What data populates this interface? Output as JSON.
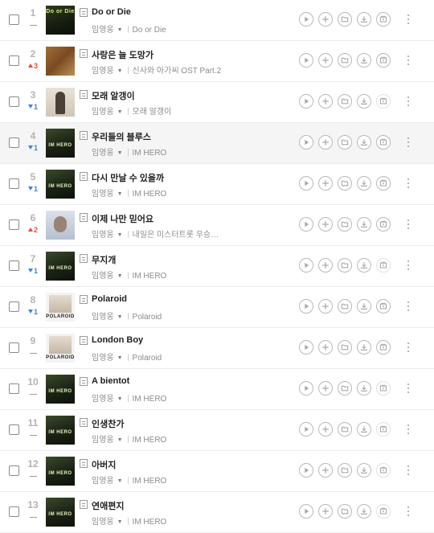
{
  "tracks": [
    {
      "rank": "1",
      "change": {
        "dir": "same",
        "value": ""
      },
      "title": "Do or Die",
      "artist": "임영웅",
      "album": "Do or Die",
      "art": "dord",
      "cover_text": "Do or Die",
      "last_active": true
    },
    {
      "rank": "2",
      "change": {
        "dir": "up",
        "value": "3"
      },
      "title": "사랑은 늘 도망가",
      "artist": "임영웅",
      "album": "신사와 아가씨 OST Part.2",
      "art": "love",
      "cover_text": "",
      "last_active": true
    },
    {
      "rank": "3",
      "change": {
        "dir": "down",
        "value": "1"
      },
      "title": "모래 알갱이",
      "artist": "임영웅",
      "album": "모래 알갱이",
      "art": "sand",
      "cover_text": "",
      "last_active": false
    },
    {
      "rank": "4",
      "change": {
        "dir": "down",
        "value": "1"
      },
      "title": "우리들의 블루스",
      "artist": "임영웅",
      "album": "IM HERO",
      "art": "hero",
      "cover_text": "IM HERO",
      "last_active": true
    },
    {
      "rank": "5",
      "change": {
        "dir": "down",
        "value": "1"
      },
      "title": "다시 만날 수 있을까",
      "artist": "임영웅",
      "album": "IM HERO",
      "art": "hero",
      "cover_text": "IM HERO",
      "last_active": true
    },
    {
      "rank": "6",
      "change": {
        "dir": "up",
        "value": "2"
      },
      "title": "이제 나만 믿어요",
      "artist": "임영웅",
      "album": "내일은 미스터트롯 우승…",
      "art": "face",
      "cover_text": "",
      "last_active": true
    },
    {
      "rank": "7",
      "change": {
        "dir": "down",
        "value": "1"
      },
      "title": "무지개",
      "artist": "임영웅",
      "album": "IM HERO",
      "art": "hero",
      "cover_text": "IM HERO",
      "last_active": false
    },
    {
      "rank": "8",
      "change": {
        "dir": "down",
        "value": "1"
      },
      "title": "Polaroid",
      "artist": "임영웅",
      "album": "Polaroid",
      "art": "pola",
      "cover_text": "POLAROID",
      "last_active": true
    },
    {
      "rank": "9",
      "change": {
        "dir": "same",
        "value": ""
      },
      "title": "London Boy",
      "artist": "임영웅",
      "album": "Polaroid",
      "art": "pola",
      "cover_text": "POLAROID",
      "last_active": true
    },
    {
      "rank": "10",
      "change": {
        "dir": "same",
        "value": ""
      },
      "title": "A bientot",
      "artist": "임영웅",
      "album": "IM HERO",
      "art": "hero",
      "cover_text": "IM HERO",
      "last_active": false
    },
    {
      "rank": "11",
      "change": {
        "dir": "same",
        "value": ""
      },
      "title": "인생찬가",
      "artist": "임영웅",
      "album": "IM HERO",
      "art": "hero",
      "cover_text": "IM HERO",
      "last_active": false
    },
    {
      "rank": "12",
      "change": {
        "dir": "same",
        "value": ""
      },
      "title": "아버지",
      "artist": "임영웅",
      "album": "IM HERO",
      "art": "hero",
      "cover_text": "IM HERO",
      "last_active": false
    },
    {
      "rank": "13",
      "change": {
        "dir": "same",
        "value": ""
      },
      "title": "연애편지",
      "artist": "임영웅",
      "album": "IM HERO",
      "art": "hero",
      "cover_text": "IM HERO",
      "last_active": false
    }
  ],
  "highlighted_rank": "4",
  "action_icons": [
    "play-icon",
    "add-icon",
    "folder-icon",
    "download-icon",
    "music-video-icon"
  ],
  "colors": {
    "rank_up": "#e84a3c",
    "rank_down": "#3a85d6",
    "highlight_row": "#f5f5f5"
  }
}
